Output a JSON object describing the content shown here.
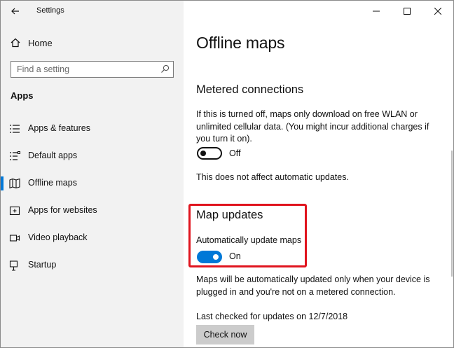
{
  "window": {
    "title": "Settings"
  },
  "sidebar": {
    "home_label": "Home",
    "search_placeholder": "Find a setting",
    "section_label": "Apps",
    "items": [
      {
        "label": "Apps & features",
        "icon": "list-icon"
      },
      {
        "label": "Default apps",
        "icon": "default-apps-icon"
      },
      {
        "label": "Offline maps",
        "icon": "map-icon",
        "active": true
      },
      {
        "label": "Apps for websites",
        "icon": "website-icon"
      },
      {
        "label": "Video playback",
        "icon": "video-icon"
      },
      {
        "label": "Startup",
        "icon": "startup-icon"
      }
    ]
  },
  "content": {
    "page_title": "Offline maps",
    "metered": {
      "heading": "Metered connections",
      "description": "If this is turned off, maps only download on free WLAN or unlimited cellular data. (You might incur additional charges if you turn it on).",
      "toggle_state": "Off",
      "note": "This does not affect automatic updates."
    },
    "map_updates": {
      "heading": "Map updates",
      "toggle_caption": "Automatically update maps",
      "toggle_state": "On",
      "description": "Maps will be automatically updated only when your device is plugged in and you're not on a metered connection.",
      "last_checked": "Last checked for updates on 12/7/2018",
      "check_button": "Check now"
    }
  },
  "colors": {
    "accent": "#0078d7",
    "highlight": "#e0141e",
    "sidebar_bg": "#f2f2f2"
  }
}
